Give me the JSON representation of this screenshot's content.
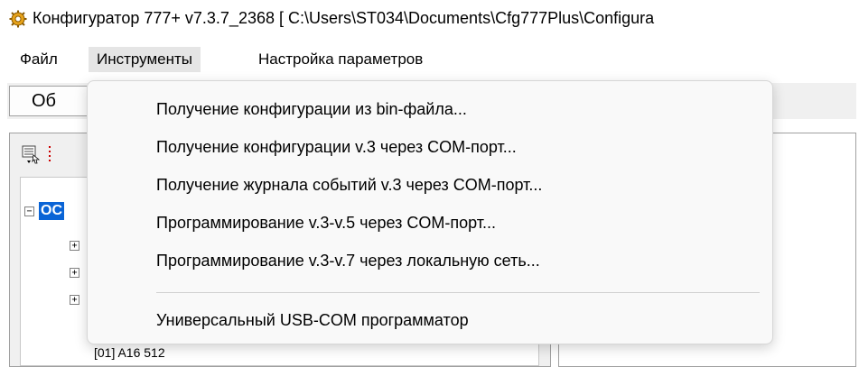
{
  "window": {
    "title": "Конфигуратор 777+ v7.3.7_2368 [ C:\\Users\\ST034\\Documents\\Cfg777Plus\\Configura"
  },
  "menubar": {
    "items": [
      {
        "label": "Файл"
      },
      {
        "label": "Инструменты"
      },
      {
        "label": "Настройка параметров"
      }
    ]
  },
  "toolbar": {
    "button_label": "Об"
  },
  "tree": {
    "root_label": "ОС"
  },
  "dropdown": {
    "items": [
      {
        "label": "Получение конфигурации из bin-файла..."
      },
      {
        "label": "Получение конфигурации v.3 через COM-порт..."
      },
      {
        "label": "Получение журнала событий v.3 через COM-порт..."
      },
      {
        "label": "Программирование v.3-v.5 через COM-порт..."
      },
      {
        "label": "Программирование v.3-v.7 через локальную сеть..."
      },
      {
        "label": "Универсальный USB-COM программатор"
      }
    ]
  },
  "bottom": {
    "partial_text": "[01] A16 512"
  },
  "icons": {
    "app": "gear-icon",
    "toolbar1": "view-icon",
    "toolbar2": "list-icon",
    "expanders": "plus-minus-icons"
  },
  "colors": {
    "selection": "#0a64d6",
    "menu_active": "#e5e5e5"
  }
}
